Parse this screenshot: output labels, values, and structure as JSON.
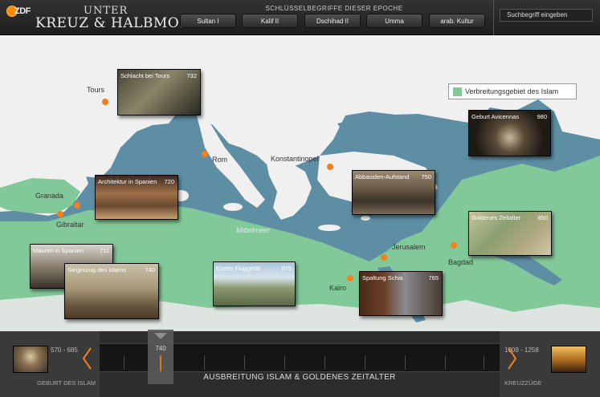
{
  "header": {
    "logo_text": "ZDF",
    "title_line1": "UNTER",
    "title_line2": "KREUZ & HALBMOND",
    "keywords_caption": "SCHLÜSSELBEGRIFFE DIESER EPOCHE",
    "keywords": [
      "Sultan I",
      "Kalif II",
      "Dschihad II",
      "Umma",
      "arab. Kultur"
    ],
    "search_placeholder": "Suchbegriff eingeben"
  },
  "map": {
    "legend_label": "Verbreitungsgebiet des Islam",
    "colors": {
      "sea": "#5d8ea3",
      "land": "#f0f0f0",
      "islam": "#82c99a",
      "city": "#f57f1a"
    },
    "sea_label": "Mittelmeer",
    "cities": [
      "Tours",
      "Rom",
      "Konstantinopel",
      "Granada",
      "Gibraltar",
      "Jerusalem",
      "Bagdad",
      "Kairo"
    ],
    "events": [
      {
        "title": "Schlacht bei Tours",
        "year": "732"
      },
      {
        "title": "Geburt Avicennas",
        "year": "980"
      },
      {
        "title": "Architektur in Spanien",
        "year": "720"
      },
      {
        "title": "Abbasiden-Aufstand",
        "year": "750"
      },
      {
        "title": "Goldenes Zeitalter",
        "year": "850"
      },
      {
        "title": "Mauren in Spanien",
        "year": "711"
      },
      {
        "title": "Siegeszug des Islams",
        "year": "740"
      },
      {
        "title": "Erstes Fluggerät",
        "year": "875"
      },
      {
        "title": "Spaltung Schia",
        "year": "765"
      }
    ]
  },
  "timeline": {
    "prev_range": "570 - 685",
    "prev_label": "GEBURT DES ISLAM",
    "next_range": "1009 - 1258",
    "next_label": "KREUZZÜGE",
    "current_year": "740",
    "epoch_title": "AUSBREITUNG ISLAM & GOLDENES ZEITALTER"
  }
}
